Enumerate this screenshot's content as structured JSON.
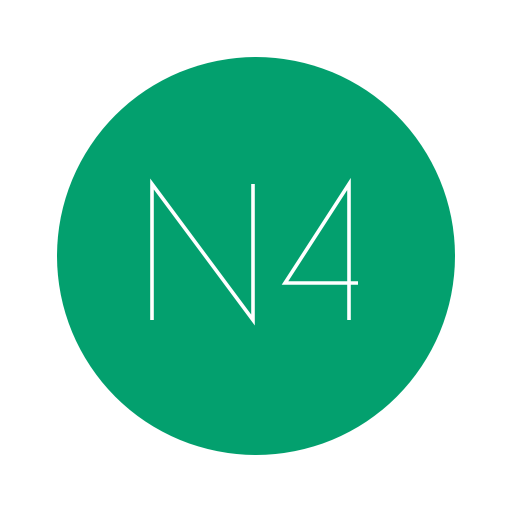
{
  "app_icon": {
    "label": "N4",
    "background_color": "#03A06E",
    "glyph_color": "#FFFFFF",
    "shape": "circle"
  }
}
